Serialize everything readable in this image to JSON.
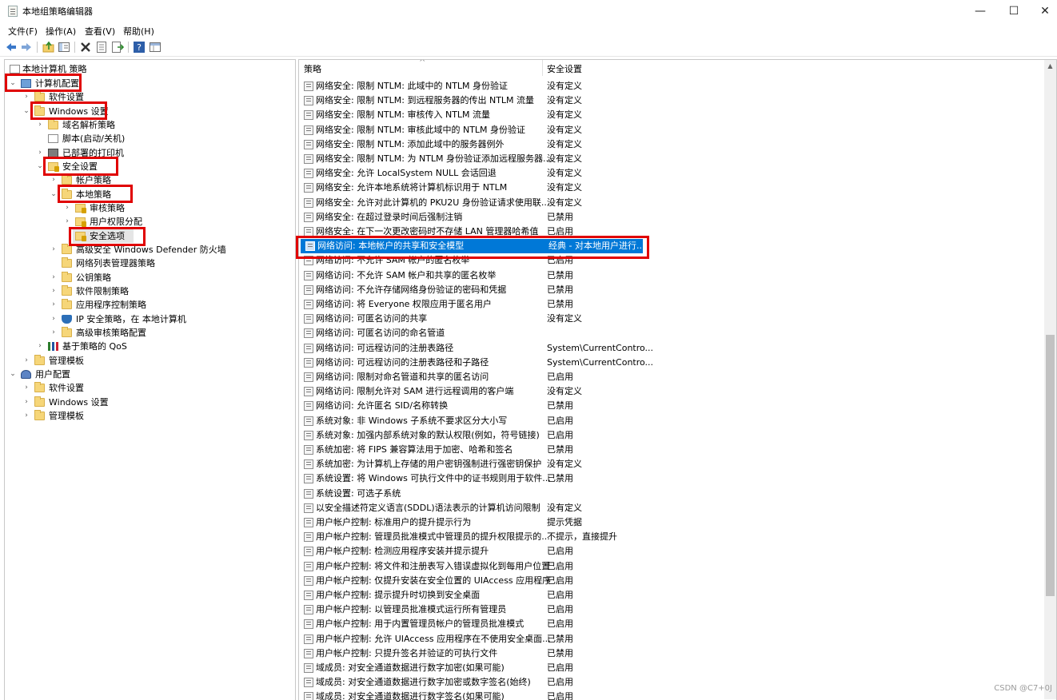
{
  "window": {
    "title": "本地组策略编辑器",
    "minimize": "—",
    "maximize": "☐",
    "close": "✕"
  },
  "menu": [
    "文件(F)",
    "操作(A)",
    "查看(V)",
    "帮助(H)"
  ],
  "tree": [
    {
      "label": "本地计算机 策略",
      "icon": "policy-icon",
      "arrow": ""
    },
    {
      "label": "计算机配置",
      "icon": "computer-icon",
      "arrow": "⌄"
    },
    {
      "label": "软件设置",
      "icon": "folder-icon",
      "arrow": "›"
    },
    {
      "label": "Windows 设置",
      "icon": "folder-icon",
      "arrow": "⌄"
    },
    {
      "label": "域名解析策略",
      "icon": "folder-icon",
      "arrow": "›"
    },
    {
      "label": "脚本(启动/关机)",
      "icon": "script-icon",
      "arrow": ""
    },
    {
      "label": "已部署的打印机",
      "icon": "printer-icon",
      "arrow": "›"
    },
    {
      "label": "安全设置",
      "icon": "security-icon",
      "arrow": "⌄"
    },
    {
      "label": "帐户策略",
      "icon": "folder-icon",
      "arrow": "›"
    },
    {
      "label": "本地策略",
      "icon": "folder-icon",
      "arrow": "⌄"
    },
    {
      "label": "审核策略",
      "icon": "security-folder-icon",
      "arrow": "›"
    },
    {
      "label": "用户权限分配",
      "icon": "security-folder-icon",
      "arrow": "›"
    },
    {
      "label": "安全选项",
      "icon": "security-folder-icon",
      "arrow": ""
    },
    {
      "label": "高级安全 Windows Defender 防火墙",
      "icon": "folder-icon",
      "arrow": "›"
    },
    {
      "label": "网络列表管理器策略",
      "icon": "folder-icon",
      "arrow": ""
    },
    {
      "label": "公钥策略",
      "icon": "folder-icon",
      "arrow": "›"
    },
    {
      "label": "软件限制策略",
      "icon": "folder-icon",
      "arrow": "›"
    },
    {
      "label": "应用程序控制策略",
      "icon": "folder-icon",
      "arrow": "›"
    },
    {
      "label": "IP 安全策略，在 本地计算机",
      "icon": "shield-icon",
      "arrow": "›"
    },
    {
      "label": "高级审核策略配置",
      "icon": "folder-icon",
      "arrow": "›"
    },
    {
      "label": "基于策略的 QoS",
      "icon": "qos-icon",
      "arrow": "›"
    },
    {
      "label": "管理模板",
      "icon": "folder-icon",
      "arrow": "›"
    },
    {
      "label": "用户配置",
      "icon": "user-icon",
      "arrow": "⌄"
    },
    {
      "label": "软件设置",
      "icon": "folder-icon",
      "arrow": "›"
    },
    {
      "label": "Windows 设置",
      "icon": "folder-icon",
      "arrow": "›"
    },
    {
      "label": "管理模板",
      "icon": "folder-icon",
      "arrow": "›"
    }
  ],
  "list": {
    "col_policy": "策略",
    "col_setting": "安全设置",
    "rows": [
      {
        "policy": "网络安全: 限制 NTLM: 此域中的 NTLM 身份验证",
        "setting": "没有定义"
      },
      {
        "policy": "网络安全: 限制 NTLM: 到远程服务器的传出 NTLM 流量",
        "setting": "没有定义"
      },
      {
        "policy": "网络安全: 限制 NTLM: 审核传入 NTLM 流量",
        "setting": "没有定义"
      },
      {
        "policy": "网络安全: 限制 NTLM: 审核此域中的 NTLM 身份验证",
        "setting": "没有定义"
      },
      {
        "policy": "网络安全: 限制 NTLM: 添加此域中的服务器例外",
        "setting": "没有定义"
      },
      {
        "policy": "网络安全: 限制 NTLM: 为 NTLM 身份验证添加远程服务器...",
        "setting": "没有定义"
      },
      {
        "policy": "网络安全: 允许 LocalSystem NULL 会话回退",
        "setting": "没有定义"
      },
      {
        "policy": "网络安全: 允许本地系统将计算机标识用于 NTLM",
        "setting": "没有定义"
      },
      {
        "policy": "网络安全: 允许对此计算机的 PKU2U 身份验证请求使用联...",
        "setting": "没有定义"
      },
      {
        "policy": "网络安全: 在超过登录时间后强制注销",
        "setting": "已禁用"
      },
      {
        "policy": "网络安全: 在下一次更改密码时不存储 LAN 管理器哈希值",
        "setting": "已启用"
      },
      {
        "policy": "网络访问: 本地帐户的共享和安全模型",
        "setting": "经典 - 对本地用户进行..."
      },
      {
        "policy": "网络访问: 不允许 SAM 帐户的匿名枚举",
        "setting": "已启用"
      },
      {
        "policy": "网络访问: 不允许 SAM 帐户和共享的匿名枚举",
        "setting": "已禁用"
      },
      {
        "policy": "网络访问: 不允许存储网络身份验证的密码和凭据",
        "setting": "已禁用"
      },
      {
        "policy": "网络访问: 将 Everyone 权限应用于匿名用户",
        "setting": "已禁用"
      },
      {
        "policy": "网络访问: 可匿名访问的共享",
        "setting": "没有定义"
      },
      {
        "policy": "网络访问: 可匿名访问的命名管道",
        "setting": ""
      },
      {
        "policy": "网络访问: 可远程访问的注册表路径",
        "setting": "System\\CurrentContro..."
      },
      {
        "policy": "网络访问: 可远程访问的注册表路径和子路径",
        "setting": "System\\CurrentContro..."
      },
      {
        "policy": "网络访问: 限制对命名管道和共享的匿名访问",
        "setting": "已启用"
      },
      {
        "policy": "网络访问: 限制允许对 SAM 进行远程调用的客户端",
        "setting": "没有定义"
      },
      {
        "policy": "网络访问: 允许匿名 SID/名称转换",
        "setting": "已禁用"
      },
      {
        "policy": "系统对象: 非 Windows 子系统不要求区分大小写",
        "setting": "已启用"
      },
      {
        "policy": "系统对象: 加强内部系统对象的默认权限(例如，符号链接)",
        "setting": "已启用"
      },
      {
        "policy": "系统加密: 将 FIPS 兼容算法用于加密、哈希和签名",
        "setting": "已禁用"
      },
      {
        "policy": "系统加密: 为计算机上存储的用户密钥强制进行强密钥保护",
        "setting": "没有定义"
      },
      {
        "policy": "系统设置: 将 Windows 可执行文件中的证书规则用于软件...",
        "setting": "已禁用"
      },
      {
        "policy": "系统设置: 可选子系统",
        "setting": ""
      },
      {
        "policy": "以安全描述符定义语言(SDDL)语法表示的计算机访问限制",
        "setting": "没有定义"
      },
      {
        "policy": "用户帐户控制: 标准用户的提升提示行为",
        "setting": "提示凭据"
      },
      {
        "policy": "用户帐户控制: 管理员批准模式中管理员的提升权限提示的...",
        "setting": "不提示，直接提升"
      },
      {
        "policy": "用户帐户控制: 检测应用程序安装并提示提升",
        "setting": "已启用"
      },
      {
        "policy": "用户帐户控制: 将文件和注册表写入错误虚拟化到每用户位置",
        "setting": "已启用"
      },
      {
        "policy": "用户帐户控制: 仅提升安装在安全位置的 UIAccess 应用程序",
        "setting": "已启用"
      },
      {
        "policy": "用户帐户控制: 提示提升时切换到安全桌面",
        "setting": "已启用"
      },
      {
        "policy": "用户帐户控制: 以管理员批准模式运行所有管理员",
        "setting": "已启用"
      },
      {
        "policy": "用户帐户控制: 用于内置管理员帐户的管理员批准模式",
        "setting": "已启用"
      },
      {
        "policy": "用户帐户控制: 允许 UIAccess 应用程序在不使用安全桌面...",
        "setting": "已禁用"
      },
      {
        "policy": "用户帐户控制: 只提升签名并验证的可执行文件",
        "setting": "已禁用"
      },
      {
        "policy": "域成员: 对安全通道数据进行数字加密(如果可能)",
        "setting": "已启用"
      },
      {
        "policy": "域成员: 对安全通道数据进行数字加密或数字签名(始终)",
        "setting": "已启用"
      },
      {
        "policy": "域成员: 对安全通道数据进行数字签名(如果可能)",
        "setting": "已启用"
      }
    ]
  },
  "watermark": "CSDN @C7+0J"
}
